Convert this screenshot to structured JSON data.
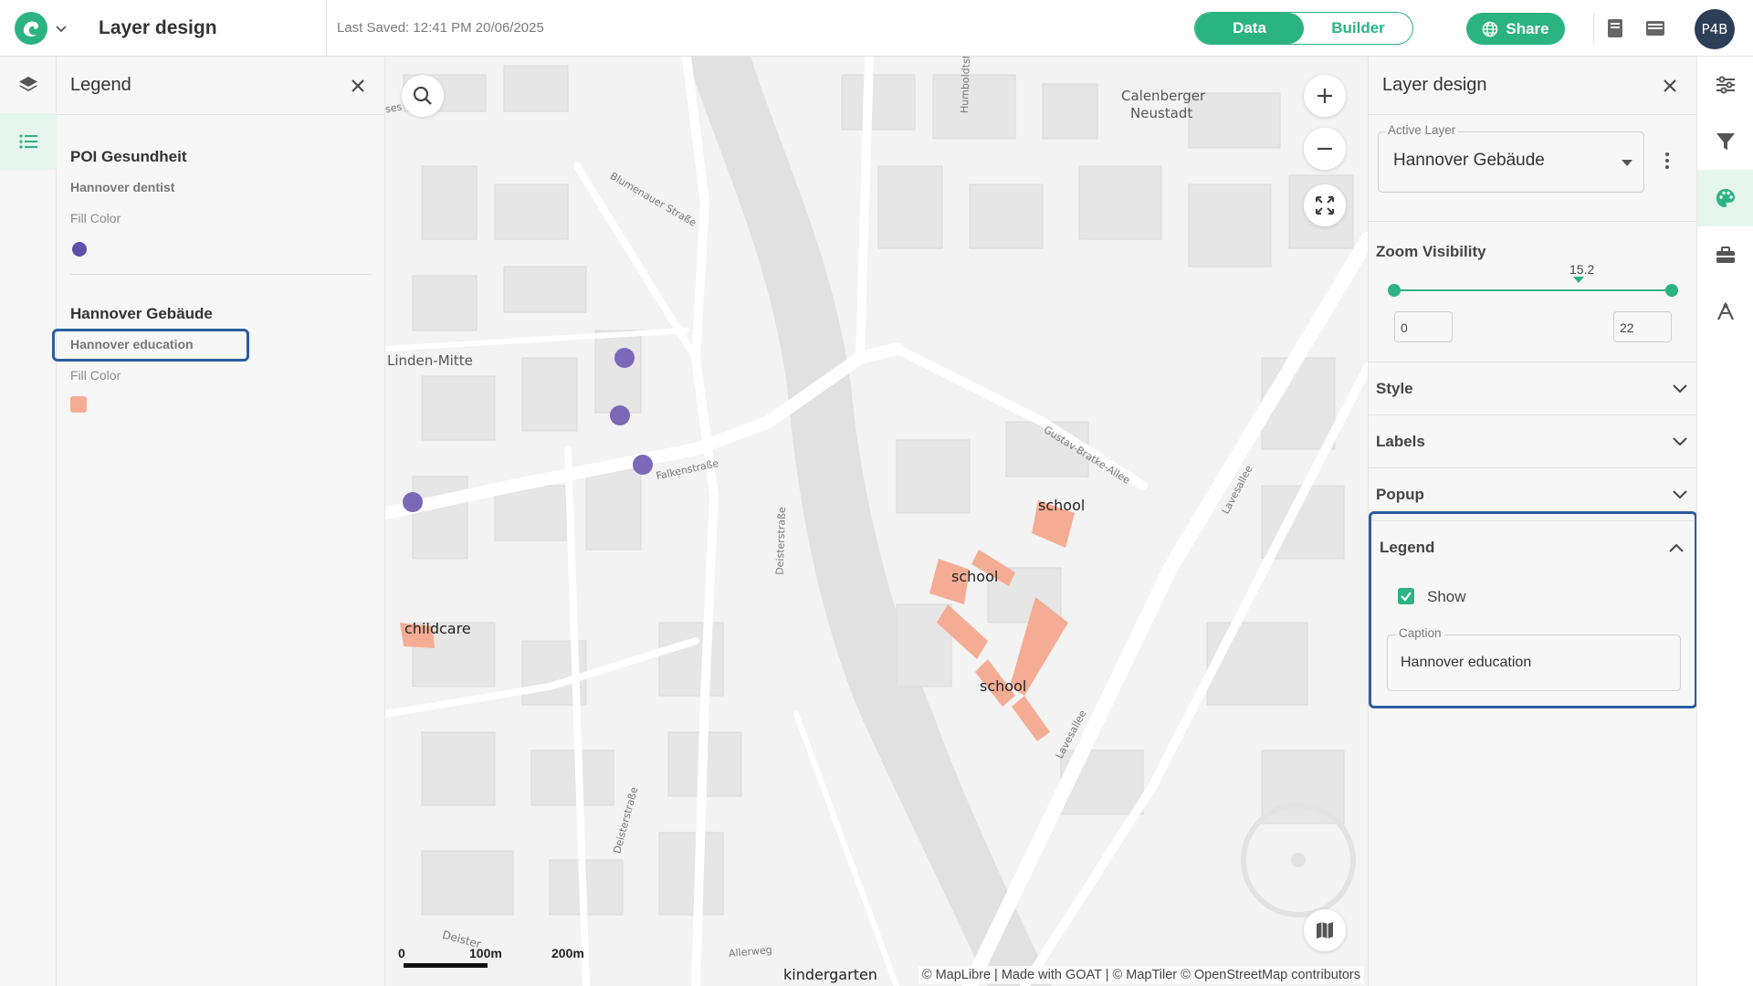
{
  "header": {
    "title": "Layer design",
    "last_saved": "Last Saved: 12:41 PM 20/06/2025",
    "toggle": {
      "data": "Data",
      "builder": "Builder"
    },
    "share_label": "Share",
    "avatar_initials": "P4B"
  },
  "legend_panel": {
    "title": "Legend",
    "layers": [
      {
        "name": "POI Gesundheit",
        "sublayer": "Hannover dentist",
        "fill_label": "Fill Color",
        "color": "#5b4fa8"
      },
      {
        "name": "Hannover Gebäude",
        "sublayer": "Hannover education",
        "fill_label": "Fill Color",
        "color": "#f4ad94"
      }
    ]
  },
  "map": {
    "labels": {
      "calenberger": "Calenberger",
      "neustadt": "Neustadt",
      "linden": "Linden-Mitte",
      "blumenauer": "Blumenauer Straße",
      "falken": "Falkenstraße",
      "deister": "Deisterstraße",
      "deister2": "Deisterstraße",
      "gustav": "Gustav-Bratke-Allee",
      "lavesallee": "Lavesallee",
      "lavesallee2": "Lavesallee",
      "humboldt": "Humboldtstr.",
      "allerweg": "Allerweg",
      "deister3": "Deister",
      "ses": "ses",
      "school1": "school",
      "school2": "school",
      "school3": "school",
      "childcare": "childcare",
      "kindergarten": "kindergarten"
    },
    "scale": {
      "zero": "0",
      "mid": "100m",
      "end": "200m"
    },
    "attribution": "© MapLibre | Made with GOAT | © MapTiler © OpenStreetMap contributors",
    "poi_color": "#7b68b8",
    "building_color": "#f4ad94"
  },
  "design_panel": {
    "title": "Layer design",
    "active_layer_label": "Active Layer",
    "active_layer_value": "Hannover Gebäude",
    "zoom_visibility": "Zoom Visibility",
    "zoom_current": "15.2",
    "zoom_min": "0",
    "zoom_max": "22",
    "sections": {
      "style": "Style",
      "labels": "Labels",
      "popup": "Popup",
      "legend": "Legend"
    },
    "legend_show_label": "Show",
    "caption_label": "Caption",
    "caption_value": "Hannover education"
  },
  "colors": {
    "accent": "#2bb381",
    "highlight": "#2d5c9f"
  },
  "icons": [
    "logo-icon",
    "chevron-down-icon",
    "globe-icon",
    "book-icon",
    "table-icon",
    "layers-icon",
    "list-icon",
    "close-icon",
    "search-icon",
    "plus-icon",
    "minus-icon",
    "fullscreen-icon",
    "basemap-icon",
    "more-vert-icon",
    "sliders-icon",
    "filter-icon",
    "palette-icon",
    "toolbox-icon",
    "scenario-icon",
    "check-icon"
  ]
}
